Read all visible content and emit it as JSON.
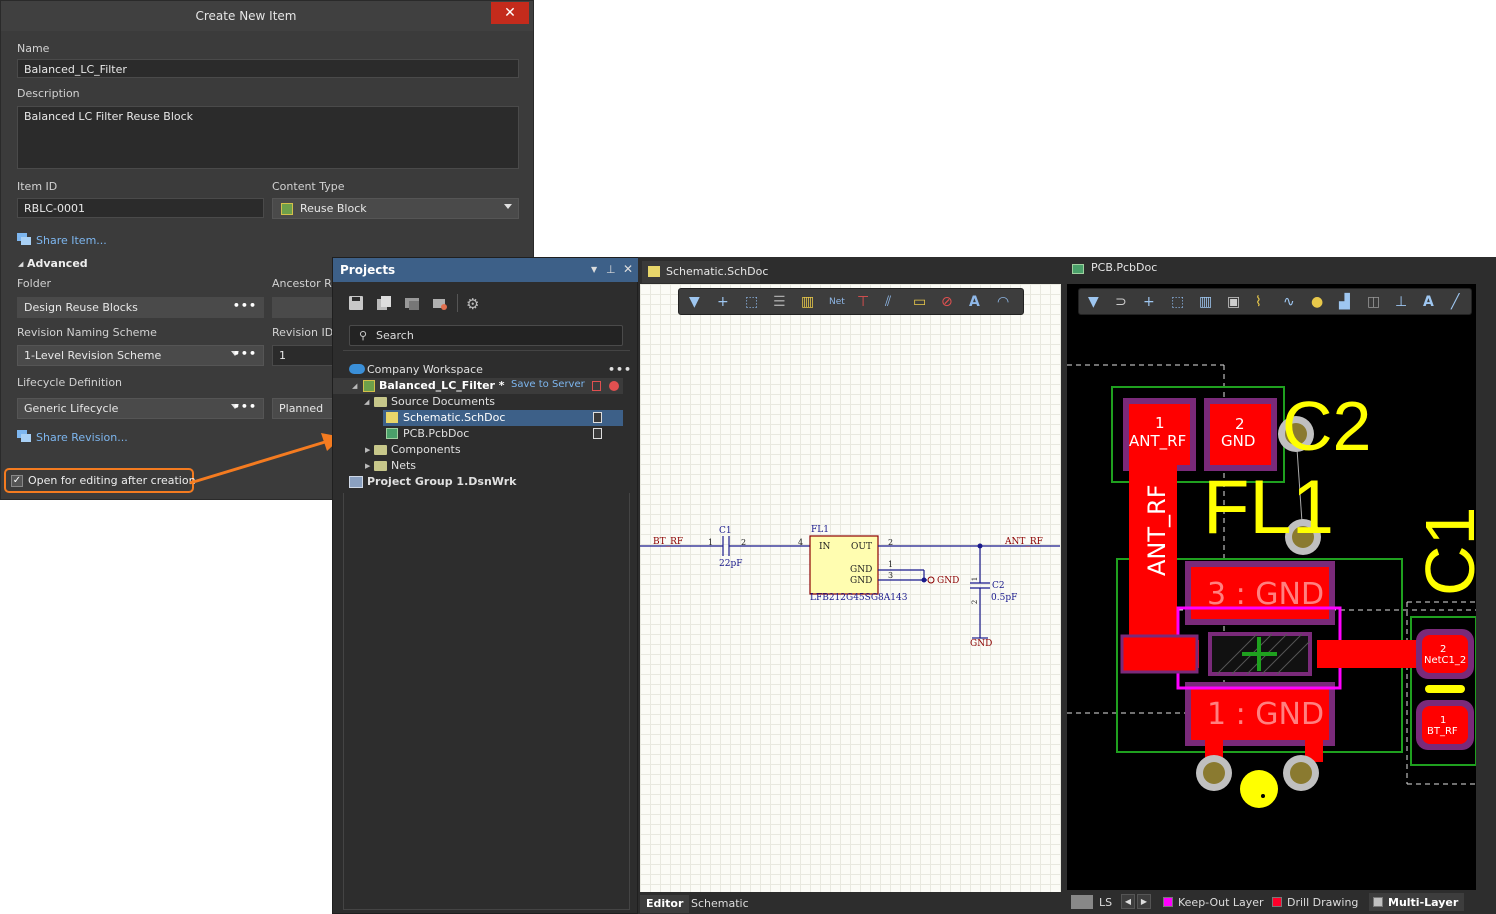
{
  "dialog": {
    "title": "Create New Item",
    "close_glyph": "✕",
    "name_label": "Name",
    "name_value": "Balanced_LC_Filter",
    "description_label": "Description",
    "description_value": "Balanced LC Filter Reuse Block",
    "item_id_label": "Item ID",
    "item_id_value": "RBLC-0001",
    "content_type_label": "Content Type",
    "content_type_value": "Reuse Block",
    "share_item_link": "Share Item...",
    "advanced_label": "Advanced",
    "folder_label": "Folder",
    "folder_value": "Design Reuse Blocks",
    "ancestor_label": "Ancestor Re",
    "revision_naming_label": "Revision Naming Scheme",
    "revision_naming_value": "1-Level Revision Scheme",
    "revision_id_label": "Revision ID",
    "revision_id_value": "1",
    "lifecycle_label": "Lifecycle Definition",
    "lifecycle_value": "Generic Lifecycle",
    "lifecycle_state_value": "Planned",
    "share_revision_link": "Share Revision...",
    "open_for_editing_label": "Open for editing after creation",
    "open_for_editing_checked": true
  },
  "projects": {
    "title": "Projects",
    "search_placeholder": "Search",
    "tree": {
      "workspace": "Company Workspace",
      "project": "Balanced_LC_Filter *",
      "save_to_server": "Save to Server",
      "source_documents": "Source Documents",
      "schematic_doc": "Schematic.SchDoc",
      "pcb_doc": "PCB.PcbDoc",
      "components": "Components",
      "nets": "Nets",
      "project_group": "Project Group 1.DsnWrk"
    }
  },
  "schematic": {
    "tab_label": "Schematic.SchDoc",
    "bottom_tabs": [
      "Editor",
      "Schematic"
    ],
    "net_left": "BT_RF",
    "net_right": "ANT_RF",
    "c1_ref": "C1",
    "c1_value": "22pF",
    "c1_pin1": "1",
    "c1_pin2": "2",
    "fl1_ref": "FL1",
    "fl1_part": "LFB212G45SG8A143",
    "fl1_pin_in": "IN",
    "fl1_pin_out": "OUT",
    "fl1_pin_gnd1": "GND",
    "fl1_pin_gnd2": "GND",
    "fl1_pin4": "4",
    "fl1_pin2": "2",
    "fl1_pin1": "1",
    "fl1_pin3": "3",
    "gnd_label": "GND",
    "c2_ref": "C2",
    "c2_value": "0.5pF",
    "c2_pin1": "1",
    "c2_pin2": "2",
    "gnd_label2": "GND"
  },
  "pcb": {
    "tab_label": "PCB.PcbDoc",
    "pad1_num": "1",
    "pad1_net": "ANT_RF",
    "pad2_num": "2",
    "pad2_net": "GND",
    "c2_designator": "C2",
    "fl1_designator": "FL1",
    "c1_designator": "C1",
    "ant_rf_track": "ANT_RF",
    "pad3_label": "3 : GND",
    "pad1_label": "1 : GND",
    "c1_pad2_num": "2",
    "c1_pad2_net": "NetC1_2",
    "c1_pad1_num": "1",
    "c1_pad1_net": "BT_RF",
    "layer_ls": "LS",
    "layers": [
      {
        "name": "Keep-Out Layer",
        "color": "#ff00ff"
      },
      {
        "name": "Drill Drawing",
        "color": "#ff002a"
      },
      {
        "name": "Multi-Layer",
        "color": "#c0c0c0"
      }
    ]
  }
}
